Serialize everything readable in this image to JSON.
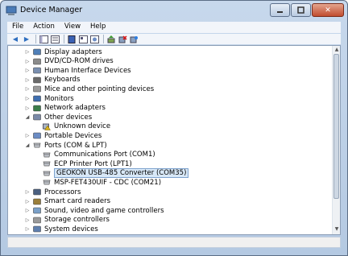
{
  "window": {
    "title": "Device Manager"
  },
  "menu": [
    "File",
    "Action",
    "View",
    "Help"
  ],
  "tree": [
    {
      "label": "Display adapters",
      "indent": 1,
      "expander": "collapsed",
      "icon": "display-adapter-icon"
    },
    {
      "label": "DVD/CD-ROM drives",
      "indent": 1,
      "expander": "collapsed",
      "icon": "dvd-drive-icon"
    },
    {
      "label": "Human Interface Devices",
      "indent": 1,
      "expander": "collapsed",
      "icon": "hid-icon"
    },
    {
      "label": "Keyboards",
      "indent": 1,
      "expander": "collapsed",
      "icon": "keyboard-icon"
    },
    {
      "label": "Mice and other pointing devices",
      "indent": 1,
      "expander": "collapsed",
      "icon": "mouse-icon"
    },
    {
      "label": "Monitors",
      "indent": 1,
      "expander": "collapsed",
      "icon": "monitor-icon"
    },
    {
      "label": "Network adapters",
      "indent": 1,
      "expander": "collapsed",
      "icon": "network-adapter-icon"
    },
    {
      "label": "Other devices",
      "indent": 1,
      "expander": "expanded",
      "icon": "other-devices-icon"
    },
    {
      "label": "Unknown device",
      "indent": 2,
      "expander": "none",
      "icon": "unknown-device-warning-icon"
    },
    {
      "label": "Portable Devices",
      "indent": 1,
      "expander": "collapsed",
      "icon": "portable-devices-icon"
    },
    {
      "label": "Ports (COM & LPT)",
      "indent": 1,
      "expander": "expanded",
      "icon": "ports-icon"
    },
    {
      "label": "Communications Port (COM1)",
      "indent": 2,
      "expander": "none",
      "icon": "port-icon"
    },
    {
      "label": "ECP Printer Port (LPT1)",
      "indent": 2,
      "expander": "none",
      "icon": "port-icon"
    },
    {
      "label": "GEOKON USB-485 Converter (COM35)",
      "indent": 2,
      "expander": "none",
      "icon": "port-icon",
      "selected": true
    },
    {
      "label": "MSP-FET430UIF - CDC (COM21)",
      "indent": 2,
      "expander": "none",
      "icon": "port-icon"
    },
    {
      "label": "Processors",
      "indent": 1,
      "expander": "collapsed",
      "icon": "processor-icon"
    },
    {
      "label": "Smart card readers",
      "indent": 1,
      "expander": "collapsed",
      "icon": "smart-card-reader-icon"
    },
    {
      "label": "Sound, video and game controllers",
      "indent": 1,
      "expander": "collapsed",
      "icon": "sound-icon"
    },
    {
      "label": "Storage controllers",
      "indent": 1,
      "expander": "collapsed",
      "icon": "storage-controller-icon"
    },
    {
      "label": "System devices",
      "indent": 1,
      "expander": "collapsed",
      "icon": "system-devices-icon"
    }
  ],
  "colors": {
    "selection": "#d8e8f7",
    "selection_border": "#7da2ce",
    "chrome": "#b4c9e2"
  }
}
